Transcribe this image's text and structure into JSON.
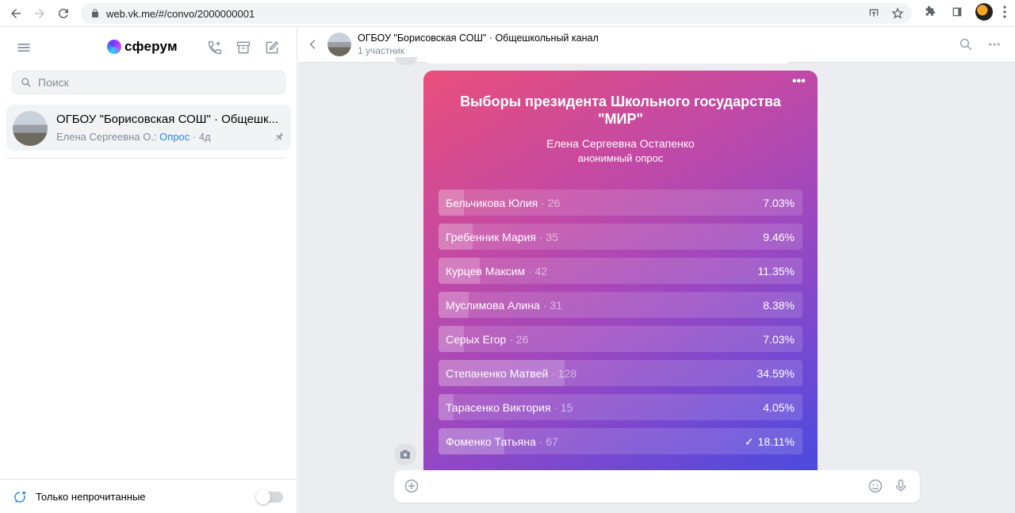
{
  "browser": {
    "url": "web.vk.me/#/convo/2000000001"
  },
  "sidebar": {
    "logo_text": "сферум",
    "search_placeholder": "Поиск",
    "conversation": {
      "title": "ОГБОУ \"Борисовская СОШ\" · Общешк...",
      "sender": "Елена Сергеевна О.:",
      "preview": "Опрос",
      "time": "· 4д"
    },
    "footer_label": "Только непрочитанные"
  },
  "chat": {
    "title": "ОГБОУ \"Борисовская СОШ\" · Общешкольный канал",
    "subtitle": "1 участник",
    "composer_placeholder": ""
  },
  "poll": {
    "title": "Выборы президента Школьного государства \"МИР\"",
    "author": "Елена Сергеевна Остапенко",
    "type": "анонимный опрос",
    "options": [
      {
        "name": "Бельчикова Юлия",
        "count": "· 26",
        "percent": "7.03%",
        "value": 7.03,
        "voted": false
      },
      {
        "name": "Гребенник Мария",
        "count": "· 35",
        "percent": "9.46%",
        "value": 9.46,
        "voted": false
      },
      {
        "name": "Курцев Максим",
        "count": "· 42",
        "percent": "11.35%",
        "value": 11.35,
        "voted": false
      },
      {
        "name": "Муслимова Алина",
        "count": "· 31",
        "percent": "8.38%",
        "value": 8.38,
        "voted": false
      },
      {
        "name": "Серых Егор",
        "count": "· 26",
        "percent": "7.03%",
        "value": 7.03,
        "voted": false
      },
      {
        "name": "Степаненко Матвей",
        "count": "· 128",
        "percent": "34.59%",
        "value": 34.59,
        "voted": false
      },
      {
        "name": "Тарасенко Виктория",
        "count": "· 15",
        "percent": "4.05%",
        "value": 4.05,
        "voted": false
      },
      {
        "name": "Фоменко Татьяна",
        "count": "· 67",
        "percent": "18.11%",
        "value": 18.11,
        "voted": true
      }
    ]
  },
  "colors": {
    "accent": "#2688eb",
    "poll_gradient_start": "#ea4f7b",
    "poll_gradient_end": "#4a4bdf"
  }
}
